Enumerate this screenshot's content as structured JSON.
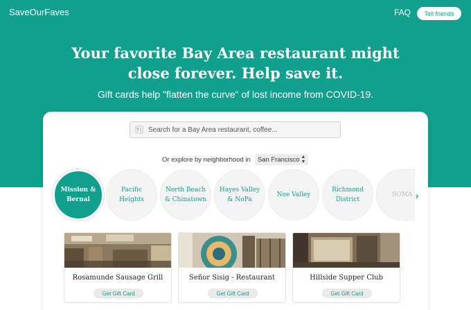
{
  "header": {
    "brand": "SaveOurFaves",
    "faq_label": "FAQ",
    "tell_friends_label": "Tell friends"
  },
  "hero": {
    "headline_line1": "Your favorite Bay Area restaurant might",
    "headline_line2": "close forever. Help save it.",
    "subline": "Gift cards help \"flatten the curve\" of lost income from COVID-19."
  },
  "search": {
    "placeholder": "Search for a Bay Area restaurant, coffee...",
    "icon": "restaurant-utensils-icon"
  },
  "explore": {
    "label": "Or explore by neighborhood in",
    "city": "San Francisco"
  },
  "neighborhoods": [
    {
      "line1": "Mission &",
      "line2": "Bernal",
      "active": true
    },
    {
      "line1": "Pacific",
      "line2": "Heights",
      "active": false
    },
    {
      "line1": "North Beach",
      "line2": "& Chinatown",
      "active": false
    },
    {
      "line1": "Hayes Valley",
      "line2": "& NoPa",
      "active": false
    },
    {
      "line1": "Noe Valley",
      "line2": "",
      "active": false
    },
    {
      "line1": "Richmond",
      "line2": "District",
      "active": false
    },
    {
      "line1": "SOMA",
      "line2": "",
      "active": false
    }
  ],
  "restaurants": [
    {
      "name": "Rosamunde Sausage Grill",
      "cta": "Get Gift Card"
    },
    {
      "name": "Señor Sisig - Restaurant",
      "cta": "Get Gift Card"
    },
    {
      "name": "Hillside Supper Club",
      "cta": "Get Gift Card"
    }
  ],
  "colors": {
    "brand_teal": "#11a08d",
    "background": "#ffffff"
  }
}
